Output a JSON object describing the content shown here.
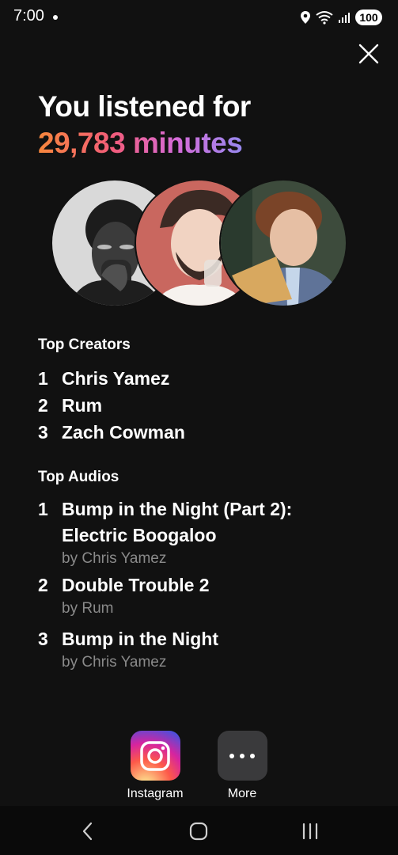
{
  "status_bar": {
    "time": "7:00",
    "battery": "100",
    "network": "6E"
  },
  "headline": {
    "line1": "You listened for",
    "minutes_value": "29,783",
    "minutes_unit": "minutes"
  },
  "top_creators": {
    "title": "Top Creators",
    "items": [
      {
        "rank": "1",
        "name": "Chris Yamez"
      },
      {
        "rank": "2",
        "name": "Rum"
      },
      {
        "rank": "3",
        "name": "Zach Cowman"
      }
    ]
  },
  "top_audios": {
    "title": "Top Audios",
    "items": [
      {
        "rank": "1",
        "title_line1": "Bump in the Night (Part 2):",
        "title_line2": "Electric Boogaloo",
        "by": "by Chris Yamez"
      },
      {
        "rank": "2",
        "title_line1": "Double Trouble 2",
        "by": "by Rum"
      },
      {
        "rank": "3",
        "title_line1": "Bump in the Night",
        "by": "by Chris Yamez"
      }
    ]
  },
  "share": {
    "instagram_label": "Instagram",
    "more_label": "More"
  },
  "icons": {
    "close": "close-icon",
    "instagram": "instagram-icon",
    "more": "more-dots-icon",
    "nav_back": "back-chevron-icon",
    "nav_home": "home-icon",
    "nav_recents": "recents-icon"
  },
  "colors": {
    "background": "#111111",
    "gradient_start": "#f7873c",
    "gradient_end": "#8f8cf2",
    "secondary_text": "#8a8a8a"
  }
}
